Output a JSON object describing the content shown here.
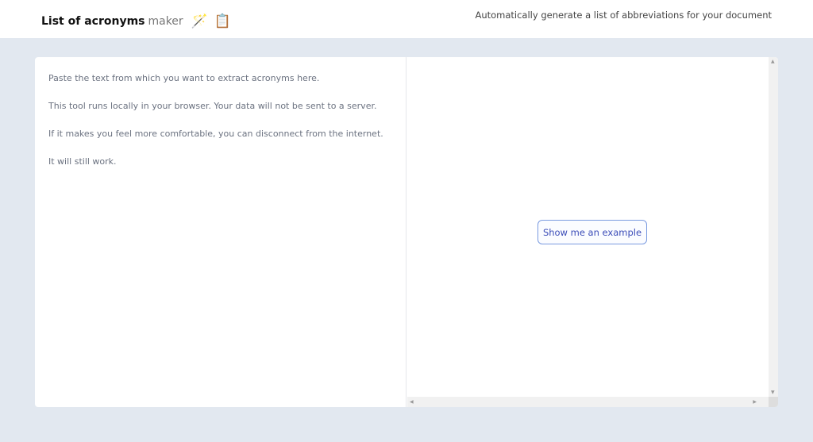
{
  "header": {
    "title_bold": "List of acronyms",
    "title_light": "maker",
    "tagline": "Automatically generate a list of abbreviations for your document"
  },
  "left_panel": {
    "placeholder_lines": [
      "Paste the text from which you want to extract acronyms here.",
      "This tool runs locally in your browser. Your data will not be sent to a server.",
      "If it makes you feel more comfortable, you can disconnect from the internet.",
      "It will still work."
    ]
  },
  "right_panel": {
    "example_button": "Show me an example"
  }
}
